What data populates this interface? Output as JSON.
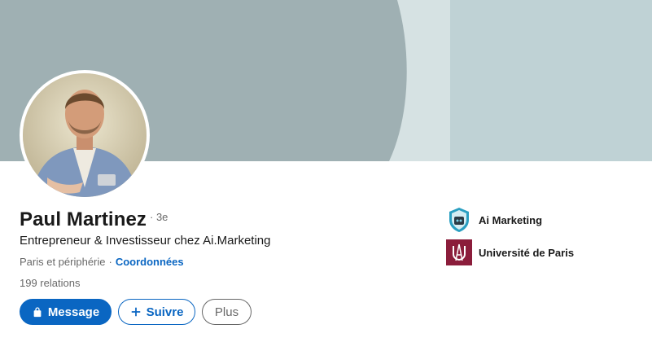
{
  "profile": {
    "name": "Paul Martinez",
    "degree": "· 3e",
    "headline": "Entrepreneur & Investisseur chez Ai.Marketing",
    "location": "Paris et périphérie",
    "separator": "·",
    "contact_link": "Coordonnées",
    "connections": "199 relations"
  },
  "actions": {
    "message_label": "Message",
    "follow_label": "Suivre",
    "more_label": "Plus"
  },
  "organizations": [
    {
      "name": "Ai Marketing",
      "logo": "ai-marketing-shield-logo"
    },
    {
      "name": "Université de Paris",
      "logo": "universite-de-paris-logo"
    }
  ],
  "icons": {
    "message": "lock-icon",
    "follow": "plus-icon"
  },
  "colors": {
    "primary": "#0a66c2",
    "banner_left": "#9fb0b3",
    "banner_middle": "#d6e2e3",
    "banner_right": "#bfd2d5",
    "university": "#8b1d3b"
  }
}
